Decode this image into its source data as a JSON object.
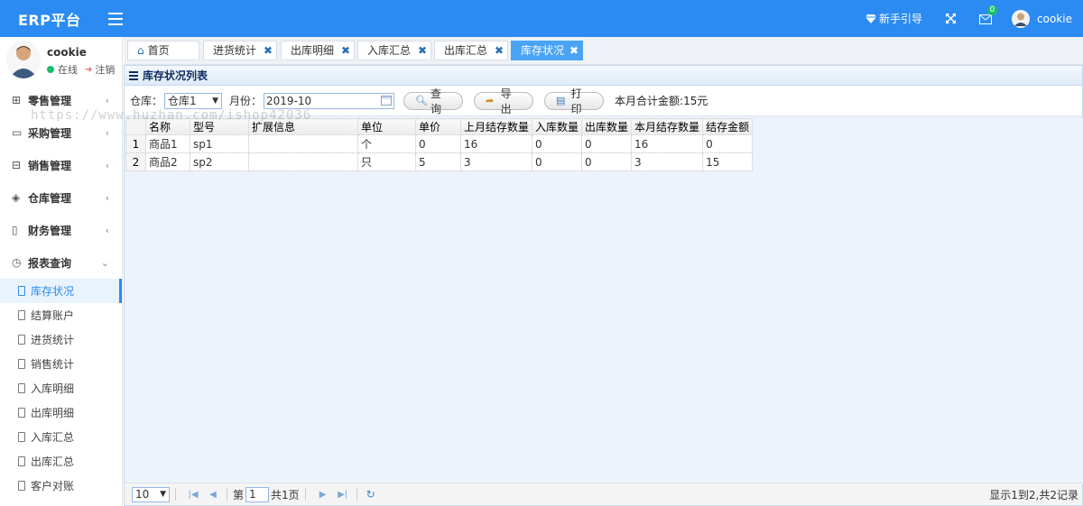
{
  "header": {
    "brand": "ERP平台",
    "guide": "新手引导",
    "mail_badge": "0",
    "username": "cookie"
  },
  "user": {
    "name": "cookie",
    "status": "在线",
    "logout": "注销"
  },
  "watermark": "https://www.huzhan.com/ishop42036",
  "nav": [
    {
      "label": "零售管理",
      "icon": "gift-icon"
    },
    {
      "label": "采购管理",
      "icon": "monitor-icon"
    },
    {
      "label": "销售管理",
      "icon": "briefcase-icon"
    },
    {
      "label": "仓库管理",
      "icon": "layers-icon"
    },
    {
      "label": "财务管理",
      "icon": "book-icon"
    },
    {
      "label": "报表查询",
      "icon": "clock-icon"
    }
  ],
  "sub_nav": [
    "库存状况",
    "结算账户",
    "进货统计",
    "销售统计",
    "入库明细",
    "出库明细",
    "入库汇总",
    "出库汇总",
    "客户对账"
  ],
  "tabs": [
    {
      "label": "首页"
    },
    {
      "label": "进货统计"
    },
    {
      "label": "出库明细"
    },
    {
      "label": "入库汇总"
    },
    {
      "label": "出库汇总"
    },
    {
      "label": "库存状况"
    }
  ],
  "panel": {
    "title": "库存状况列表",
    "warehouse_label": "仓库：",
    "warehouse_value": "仓库1",
    "month_label": "月份：",
    "month_value": "2019-10",
    "btn_query": "查询",
    "btn_export": "导出",
    "btn_print": "打印",
    "summary": "本月合计金额:15元"
  },
  "table": {
    "columns": [
      "名称",
      "型号",
      "扩展信息",
      "单位",
      "单价",
      "上月结存数量",
      "入库数量",
      "出库数量",
      "本月结存数量",
      "结存金额"
    ],
    "rows": [
      [
        "1",
        "商品1",
        "sp1",
        "",
        "个",
        "0",
        "16",
        "0",
        "0",
        "16",
        "0"
      ],
      [
        "2",
        "商品2",
        "sp2",
        "",
        "只",
        "5",
        "3",
        "0",
        "0",
        "3",
        "15"
      ]
    ]
  },
  "pager": {
    "page_size": "10",
    "page_prefix": "第",
    "page_value": "1",
    "page_suffix": "共1页",
    "info": "显示1到2,共2记录"
  }
}
